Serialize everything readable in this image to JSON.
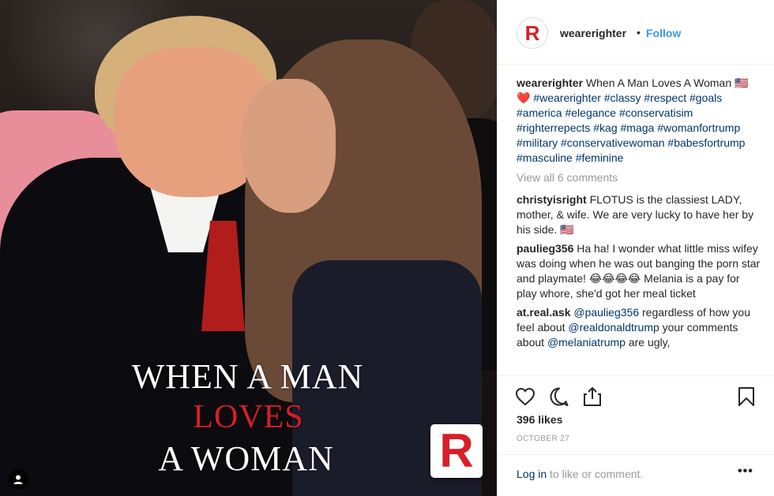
{
  "photo": {
    "overlay": {
      "line1": "WHEN A MAN",
      "line2": "LOVES",
      "line3": "A WOMAN"
    },
    "logo_letter": "R",
    "colors": {
      "accent": "#d61f26",
      "white": "#ffffff"
    }
  },
  "header": {
    "avatar_letter": "R",
    "username": "wearerighter",
    "dot": "•",
    "follow": "Follow"
  },
  "caption": {
    "username": "wearerighter",
    "text": " When A Man Loves A Woman 🇺🇸 ❤️ ",
    "hashtags": "#wearerighter #classy #respect #goals #america #elegance #conservatisim #righterrepects #kag #maga #womanfortrump #military #conservativewoman #babesfortrump #masculine #feminine"
  },
  "view_all": "View all 6 comments",
  "comments": [
    {
      "user": "christyisright",
      "text": " FLOTUS is the classiest LADY, mother, & wife. We are very lucky to have her by his side. 🇺🇸"
    },
    {
      "user": "paulieg356",
      "text": " Ha ha! I wonder what little miss wifey was doing when he was out banging the porn star and playmate! 😂😂😂😂 Melania is a pay for play whore, she'd got her meal ticket"
    },
    {
      "user": "at.real.ask",
      "mention1": " @paulieg356",
      "text1": " regardless of how you feel about ",
      "mention2": "@realdonaldtrump",
      "text2": " your comments about ",
      "mention3": "@melaniatrump",
      "text3": " are ugly,"
    }
  ],
  "actions": {
    "icons": [
      "heart-icon",
      "comment-icon",
      "share-icon",
      "bookmark-icon"
    ]
  },
  "likes": "396 likes",
  "date": "OCTOBER 27",
  "footer": {
    "login_link": "Log in",
    "login_text": " to like or comment.",
    "more": "•••"
  },
  "colors": {
    "link_blue": "#3897f0",
    "tag_blue": "#003569",
    "muted": "#999999",
    "text": "#262626"
  }
}
